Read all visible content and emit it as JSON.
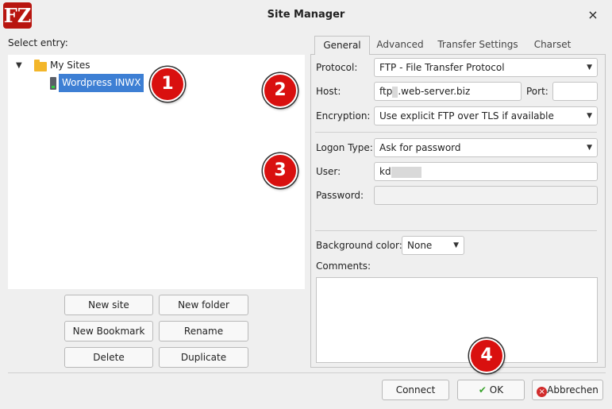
{
  "window": {
    "logo_text": "FZ",
    "title": "Site Manager",
    "close_glyph": "×"
  },
  "left_pane": {
    "select_label": "Select entry:",
    "tree": {
      "folder_label": "My Sites",
      "site_label": "Wordpress INWX"
    },
    "buttons": {
      "new_site": "New site",
      "new_folder": "New folder",
      "new_bookmark": "New Bookmark",
      "rename": "Rename",
      "delete": "Delete",
      "duplicate": "Duplicate"
    }
  },
  "tabs": [
    "General",
    "Advanced",
    "Transfer Settings",
    "Charset"
  ],
  "general": {
    "protocol_label": "Protocol:",
    "protocol_value": "FTP - File Transfer Protocol",
    "host_label": "Host:",
    "host_prefix": "ftp",
    "host_suffix": ".web-server.biz",
    "port_label": "Port:",
    "port_value": "",
    "encryption_label": "Encryption:",
    "encryption_value": "Use explicit FTP over TLS if available",
    "logon_label": "Logon Type:",
    "logon_value": "Ask for password",
    "user_label": "User:",
    "user_value": "kd",
    "password_label": "Password:",
    "password_value": "",
    "bg_color_label": "Background color:",
    "bg_color_value": "None",
    "comments_label": "Comments:",
    "comments_value": ""
  },
  "footer": {
    "connect": "Connect",
    "ok": "OK",
    "cancel": "Abbrechen"
  },
  "annotations": [
    "1",
    "2",
    "3",
    "4"
  ],
  "colors": {
    "selection": "#3d7fd4",
    "badge_red": "#d9100f",
    "logo_red": "#b8150f"
  },
  "icons": {
    "logo": "filezilla-logo-icon",
    "folder": "folder-icon",
    "server": "server-icon",
    "ok": "checkmark-icon",
    "cancel": "cancel-icon"
  }
}
